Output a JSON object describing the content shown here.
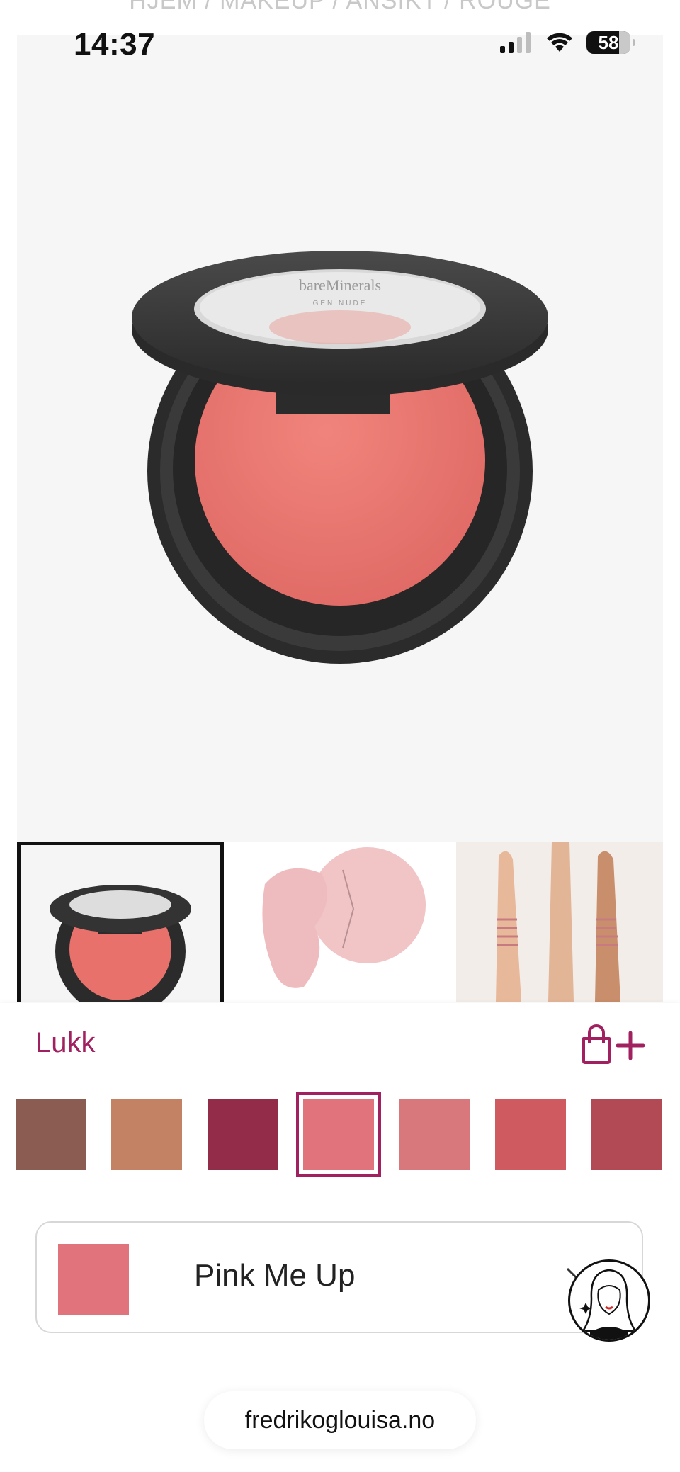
{
  "breadcrumb": "HJEM / MAKEUP / ANSIKT / ROUGE",
  "status_bar": {
    "time": "14:37",
    "battery": "58"
  },
  "product_image": {
    "brand_text": "bareMinerals",
    "line_text": "GEN NUDE"
  },
  "thumbnails": [
    {
      "name": "compact-view",
      "selected": true
    },
    {
      "name": "powder-texture",
      "selected": false
    },
    {
      "name": "arm-swatches",
      "selected": false
    }
  ],
  "sheet": {
    "close_label": "Lukk",
    "add_to_bag_icon": "bag-plus-icon",
    "swatch_colors": [
      "#8a5c52",
      "#c48265",
      "#922c48",
      "#e1737d",
      "#d8777c",
      "#cf5a60",
      "#b24a56"
    ],
    "selected_index": 3,
    "selected_shade": {
      "name": "Pink Me Up",
      "color": "#e1737d"
    }
  },
  "colors": {
    "accent": "#a1205f"
  },
  "browser": {
    "url": "fredrikoglouisa.no"
  }
}
